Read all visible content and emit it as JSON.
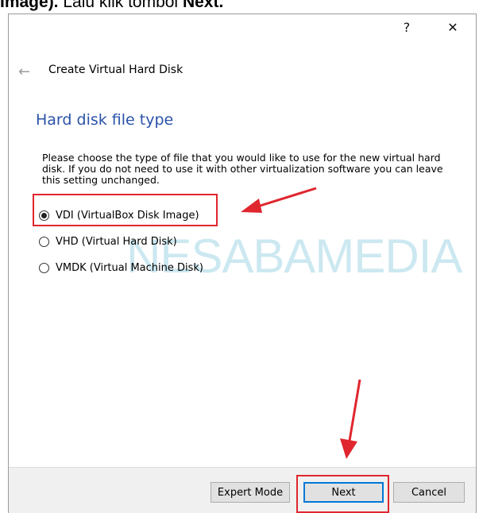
{
  "caption": {
    "part1": "Image).",
    "part2": " Lalu klik tombol ",
    "part3": "Next."
  },
  "window": {
    "help_label": "?",
    "close_label": "✕"
  },
  "wizard": {
    "back_label": "←",
    "title": "Create Virtual Hard Disk",
    "section_title": "Hard disk file type",
    "description": "Please choose the type of file that you would like to use for the new virtual hard disk. If you do not need to use it with other virtualization software you can leave this setting unchanged."
  },
  "options": [
    {
      "label": "VDI (VirtualBox Disk Image)",
      "checked": true
    },
    {
      "label": "VHD (Virtual Hard Disk)",
      "checked": false
    },
    {
      "label": "VMDK (Virtual Machine Disk)",
      "checked": false
    }
  ],
  "watermark": "NESABAMEDIA",
  "buttons": {
    "expert": "Expert Mode",
    "next": "Next",
    "cancel": "Cancel"
  },
  "colors": {
    "accent": "#2a52a8",
    "annotation": "#e0262e",
    "focus": "#0078d7"
  }
}
